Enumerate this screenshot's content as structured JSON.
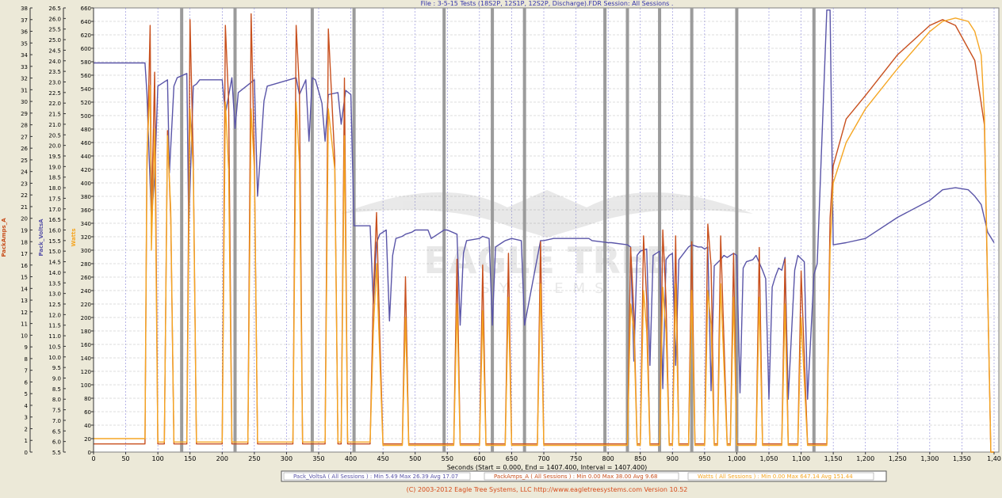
{
  "window": {
    "title": "File : 3-5-15 Tests (18S2P, 12S1P, 12S2P, Discharge).FDR   Session: All Sessions .",
    "copyright": "(C) 2003-2012 Eagle Tree Systems, LLC  http://www.eagletreesystems.com  Version 10.52"
  },
  "watermark": {
    "brand": "EAGLE TREE",
    "sub": "SYSTEMS"
  },
  "colors": {
    "volts": "#5a55a8",
    "amps": "#c8501e",
    "watts": "#f5a623",
    "marker": "#9b9b9b",
    "grid": "#8a87d8",
    "background": "#ffffff"
  },
  "chart_data": {
    "type": "line",
    "xlabel": "Seconds (Start = 0.000, End = 1407.400, Interval = 1407.400)",
    "xlim": [
      0,
      1407.4
    ],
    "x_ticks": [
      0,
      50,
      100,
      150,
      200,
      250,
      300,
      350,
      400,
      450,
      500,
      550,
      600,
      650,
      700,
      750,
      800,
      850,
      900,
      950,
      1000,
      1050,
      1100,
      1150,
      1200,
      1250,
      1300,
      1350,
      1400
    ],
    "x_tick_labels": [
      "0",
      "50",
      "100",
      "150",
      "200",
      "250",
      "300",
      "350",
      "400",
      "450",
      "500",
      "550",
      "600",
      "650",
      "700",
      "750",
      "800",
      "850",
      "900",
      "950",
      "1,000",
      "1,050",
      "1,100",
      "1,150",
      "1,200",
      "1,250",
      "1,300",
      "1,350",
      "1,40"
    ],
    "grid": true,
    "session_markers": [
      137,
      220,
      340,
      405,
      545,
      620,
      670,
      795,
      830,
      880,
      930,
      1000,
      1120
    ],
    "axes": [
      {
        "label": "PackAmps_A",
        "min": 0,
        "max": 38,
        "step": 1,
        "side": "left-outer"
      },
      {
        "label": "Pack_VoltsA",
        "min": 5.5,
        "max": 26.5,
        "step": 0.5,
        "side": "left-middle"
      },
      {
        "label": "Watts",
        "min": 0,
        "max": 660,
        "step": 20,
        "side": "left-inner"
      }
    ],
    "legend": [
      "Pack_VoltsA ( All Sessions ) : Min 5.49   Max 26.39   Avg 17.07",
      "PackAmps_A ( All Sessions ) : Min 0.00   Max 38.00   Avg 9.68",
      "Watts  ( All Sessions ) : Min 0.00   Max 647.14   Avg 151.44"
    ],
    "legend_placement": "bottom-center",
    "series": [
      {
        "name": "Pack_VoltsA",
        "axis": 1,
        "x": [
          0,
          80,
          83,
          90,
          95,
          100,
          115,
          118,
          125,
          130,
          145,
          148,
          155,
          160,
          165,
          200,
          205,
          215,
          220,
          225,
          250,
          255,
          265,
          270,
          315,
          320,
          330,
          335,
          340,
          345,
          355,
          360,
          365,
          380,
          385,
          392,
          400,
          405,
          408,
          430,
          435,
          440,
          445,
          455,
          460,
          465,
          470,
          480,
          485,
          495,
          500,
          520,
          525,
          540,
          545,
          550,
          565,
          570,
          575,
          580,
          600,
          605,
          615,
          620,
          625,
          635,
          640,
          650,
          665,
          670,
          695,
          700,
          715,
          720,
          770,
          775,
          800,
          805,
          830,
          835,
          840,
          845,
          850,
          860,
          865,
          870,
          880,
          885,
          890,
          895,
          900,
          905,
          910,
          915,
          925,
          930,
          940,
          945,
          950,
          955,
          960,
          965,
          975,
          980,
          985,
          995,
          1000,
          1005,
          1010,
          1015,
          1025,
          1030,
          1040,
          1045,
          1050,
          1055,
          1060,
          1065,
          1070,
          1075,
          1080,
          1090,
          1095,
          1105,
          1110,
          1120,
          1125,
          1140,
          1145,
          1150,
          1170,
          1200,
          1250,
          1300,
          1320,
          1340,
          1360,
          1370,
          1380,
          1390,
          1400
        ],
        "y": [
          23.9,
          23.9,
          22.5,
          16.5,
          18.5,
          22.8,
          23.1,
          18.7,
          22.8,
          23.2,
          23.4,
          16.1,
          22.8,
          22.9,
          23.1,
          23.1,
          21.5,
          23.2,
          20.8,
          22.5,
          23.1,
          17.6,
          22.1,
          22.8,
          23.2,
          22.4,
          23.1,
          20.2,
          23.2,
          23.1,
          22.0,
          20.2,
          22.4,
          22.5,
          21.0,
          22.6,
          22.4,
          16.2,
          16.2,
          16.2,
          12.5,
          15.4,
          15.8,
          16.0,
          11.7,
          14.8,
          15.6,
          15.7,
          15.8,
          15.9,
          16.0,
          16.0,
          15.6,
          15.9,
          16.0,
          16.0,
          15.8,
          11.5,
          14.9,
          15.5,
          15.6,
          15.7,
          15.6,
          11.5,
          15.2,
          15.4,
          15.5,
          15.6,
          15.5,
          11.5,
          15.5,
          15.5,
          15.6,
          15.6,
          15.6,
          15.5,
          15.4,
          15.4,
          15.3,
          15.2,
          9.8,
          14.8,
          15.0,
          15.1,
          9.6,
          14.8,
          15.0,
          8.5,
          14.6,
          14.8,
          14.9,
          9.6,
          14.6,
          14.8,
          15.2,
          15.3,
          15.2,
          15.2,
          15.1,
          15.2,
          8.4,
          14.3,
          14.6,
          14.8,
          14.7,
          14.9,
          14.8,
          8.3,
          14.2,
          14.5,
          14.6,
          14.8,
          14.1,
          13.7,
          8.0,
          13.3,
          13.8,
          14.2,
          14.1,
          14.7,
          8.0,
          14.1,
          14.8,
          14.5,
          8.0,
          13.9,
          14.4,
          26.4,
          26.4,
          15.3,
          15.4,
          15.6,
          16.6,
          17.4,
          17.9,
          18.0,
          17.9,
          17.6,
          17.2,
          15.9,
          15.4
        ]
      },
      {
        "name": "PackAmps_A",
        "axis": 0,
        "x": [
          0,
          80,
          83,
          88,
          90,
          95,
          100,
          110,
          115,
          120,
          125,
          130,
          145,
          150,
          155,
          160,
          200,
          205,
          210,
          215,
          220,
          240,
          245,
          250,
          255,
          310,
          315,
          320,
          325,
          330,
          360,
          365,
          375,
          380,
          385,
          390,
          395,
          400,
          430,
          435,
          440,
          445,
          450,
          480,
          485,
          490,
          495,
          500,
          560,
          565,
          570,
          575,
          580,
          600,
          605,
          610,
          615,
          620,
          640,
          645,
          650,
          655,
          660,
          690,
          695,
          700,
          705,
          710,
          830,
          835,
          840,
          845,
          850,
          855,
          860,
          865,
          870,
          880,
          885,
          890,
          895,
          900,
          905,
          910,
          920,
          925,
          930,
          935,
          940,
          950,
          955,
          960,
          965,
          970,
          975,
          985,
          990,
          995,
          1000,
          1005,
          1030,
          1035,
          1040,
          1045,
          1050,
          1070,
          1075,
          1080,
          1085,
          1095,
          1100,
          1110,
          1115,
          1125,
          1130,
          1140,
          1145,
          1150,
          1170,
          1200,
          1250,
          1300,
          1320,
          1340,
          1370,
          1385,
          1395,
          1400
        ],
        "y": [
          0.7,
          0.7,
          24.0,
          36.5,
          20.0,
          32.5,
          0.7,
          0.7,
          27.5,
          20.0,
          0.7,
          0.7,
          0.7,
          37.0,
          25.0,
          0.7,
          0.7,
          36.5,
          30.0,
          0.7,
          0.7,
          0.7,
          37.5,
          25.0,
          0.7,
          0.7,
          36.5,
          31.0,
          0.7,
          0.7,
          0.7,
          36.2,
          25.0,
          0.7,
          0.7,
          32.0,
          0.7,
          0.7,
          0.7,
          13.5,
          20.5,
          10.0,
          0.7,
          0.7,
          15.0,
          0.7,
          0.7,
          0.7,
          0.7,
          16.5,
          0.7,
          0.7,
          0.7,
          0.7,
          16.0,
          0.7,
          0.7,
          0.7,
          0.7,
          17.0,
          0.7,
          0.7,
          0.7,
          0.7,
          18.0,
          0.7,
          0.7,
          0.7,
          0.7,
          17.5,
          12.0,
          0.7,
          0.7,
          18.5,
          13.0,
          0.7,
          0.7,
          0.7,
          19.0,
          13.0,
          0.7,
          0.7,
          18.5,
          0.7,
          0.7,
          0.7,
          18.0,
          0.7,
          0.7,
          0.7,
          19.5,
          16.0,
          0.7,
          0.7,
          18.5,
          0.7,
          0.7,
          17.0,
          0.7,
          0.7,
          0.7,
          17.5,
          0.7,
          0.7,
          0.7,
          0.7,
          16.5,
          0.7,
          0.7,
          0.7,
          15.5,
          0.7,
          0.7,
          0.7,
          0.7,
          0.7,
          20.0,
          24.5,
          28.5,
          30.5,
          34.0,
          36.5,
          37.0,
          36.5,
          33.5,
          28.0,
          0.0,
          0.0
        ]
      },
      {
        "name": "Watts",
        "axis": 2,
        "x": [
          0,
          80,
          83,
          88,
          90,
          95,
          100,
          110,
          115,
          120,
          125,
          130,
          145,
          150,
          155,
          160,
          200,
          205,
          210,
          215,
          220,
          240,
          245,
          250,
          255,
          310,
          315,
          320,
          325,
          330,
          360,
          365,
          375,
          380,
          385,
          390,
          395,
          400,
          430,
          435,
          440,
          445,
          450,
          480,
          485,
          490,
          495,
          500,
          560,
          565,
          570,
          575,
          580,
          600,
          605,
          610,
          615,
          620,
          640,
          645,
          650,
          655,
          660,
          690,
          695,
          700,
          705,
          710,
          830,
          835,
          840,
          845,
          850,
          855,
          860,
          865,
          870,
          880,
          885,
          890,
          895,
          900,
          905,
          910,
          920,
          925,
          930,
          935,
          940,
          950,
          955,
          960,
          965,
          970,
          975,
          985,
          990,
          995,
          1000,
          1005,
          1030,
          1035,
          1040,
          1045,
          1050,
          1070,
          1075,
          1080,
          1085,
          1095,
          1100,
          1110,
          1115,
          1125,
          1130,
          1140,
          1145,
          1150,
          1170,
          1200,
          1250,
          1300,
          1320,
          1340,
          1360,
          1370,
          1380,
          1385,
          1395,
          1400
        ],
        "y": [
          20,
          20,
          440,
          545,
          300,
          480,
          15,
          15,
          470,
          360,
          15,
          15,
          15,
          510,
          420,
          15,
          15,
          520,
          420,
          15,
          15,
          15,
          510,
          420,
          15,
          15,
          520,
          430,
          15,
          15,
          15,
          510,
          420,
          15,
          15,
          470,
          15,
          15,
          15,
          180,
          280,
          140,
          10,
          10,
          200,
          10,
          10,
          10,
          10,
          220,
          10,
          10,
          10,
          10,
          210,
          10,
          10,
          10,
          10,
          230,
          10,
          10,
          10,
          10,
          250,
          10,
          10,
          10,
          10,
          220,
          180,
          10,
          10,
          240,
          180,
          10,
          10,
          10,
          245,
          180,
          10,
          10,
          250,
          10,
          10,
          10,
          240,
          10,
          10,
          10,
          240,
          190,
          10,
          10,
          250,
          10,
          10,
          230,
          10,
          10,
          10,
          230,
          10,
          10,
          10,
          10,
          220,
          10,
          10,
          10,
          200,
          10,
          10,
          10,
          10,
          10,
          300,
          400,
          460,
          510,
          570,
          625,
          640,
          645,
          640,
          625,
          590,
          500,
          0,
          0
        ]
      }
    ]
  }
}
